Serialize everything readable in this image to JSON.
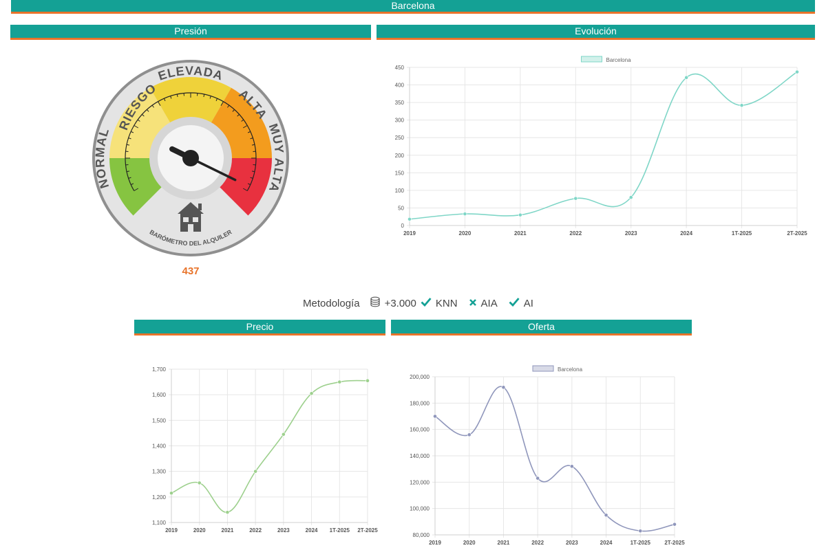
{
  "header": {
    "city": "Barcelona"
  },
  "sections": {
    "presion": "Presión",
    "evolucion": "Evolución",
    "precio": "Precio",
    "oferta": "Oferta"
  },
  "gauge": {
    "value": "437",
    "zones": [
      "NORMAL",
      "RIESGO",
      "ELEVADA",
      "ALTA",
      "MUY ALTA"
    ],
    "caption": "BARÓMETRO DEL ALQUILER",
    "level_fraction": 0.93,
    "colors": {
      "normal": "#86c441",
      "riesgo": "#f6e27a",
      "elevada": "#efd23a",
      "alta": "#f39c1e",
      "muy_alta": "#e8313f"
    }
  },
  "methodology": {
    "label": "Metodología",
    "items": [
      {
        "icon": "database-icon",
        "text": "+3.000"
      },
      {
        "icon": "check-icon",
        "text": "KNN"
      },
      {
        "icon": "cross-icon",
        "text": "AIA"
      },
      {
        "icon": "check-icon",
        "text": "AI"
      }
    ]
  },
  "chart_data": [
    {
      "type": "line",
      "title": "",
      "categories": [
        "2019",
        "2020",
        "2021",
        "2022",
        "2023",
        "2024",
        "1T-2025",
        "2T-2025"
      ],
      "series": [
        {
          "name": "Barcelona",
          "values": [
            18,
            33,
            30,
            77,
            80,
            421,
            342,
            437
          ]
        }
      ],
      "ylim": [
        0,
        450
      ],
      "yticks": [
        "0",
        "50",
        "100",
        "150",
        "200",
        "250",
        "300",
        "350",
        "400",
        "450"
      ],
      "grid": true,
      "legend": "top-center",
      "color": "#7fd6c7"
    },
    {
      "type": "line",
      "title": "",
      "categories": [
        "2019",
        "2020",
        "2021",
        "2022",
        "2023",
        "2024",
        "1T-2025",
        "2T-2025"
      ],
      "series": [
        {
          "values": [
            1215,
            1255,
            1140,
            1300,
            1445,
            1605,
            1650,
            1655
          ]
        }
      ],
      "ylim": [
        1100,
        1700
      ],
      "yticks": [
        "1,100",
        "1,200",
        "1,300",
        "1,400",
        "1,500",
        "1,600",
        "1,700"
      ],
      "grid": true,
      "color": "#9dd08d"
    },
    {
      "type": "line",
      "title": "",
      "categories": [
        "2019",
        "2020",
        "2021",
        "2022",
        "2023",
        "2024",
        "1T-2025",
        "2T-2025"
      ],
      "series": [
        {
          "name": "Barcelona",
          "values": [
            170000,
            156000,
            192000,
            123000,
            132000,
            95000,
            83000,
            88000
          ]
        }
      ],
      "ylim": [
        80000,
        200000
      ],
      "yticks": [
        "80,000",
        "100,000",
        "120,000",
        "140,000",
        "160,000",
        "180,000",
        "200,000"
      ],
      "grid": true,
      "legend": "top-center",
      "color": "#8f96bb"
    }
  ]
}
